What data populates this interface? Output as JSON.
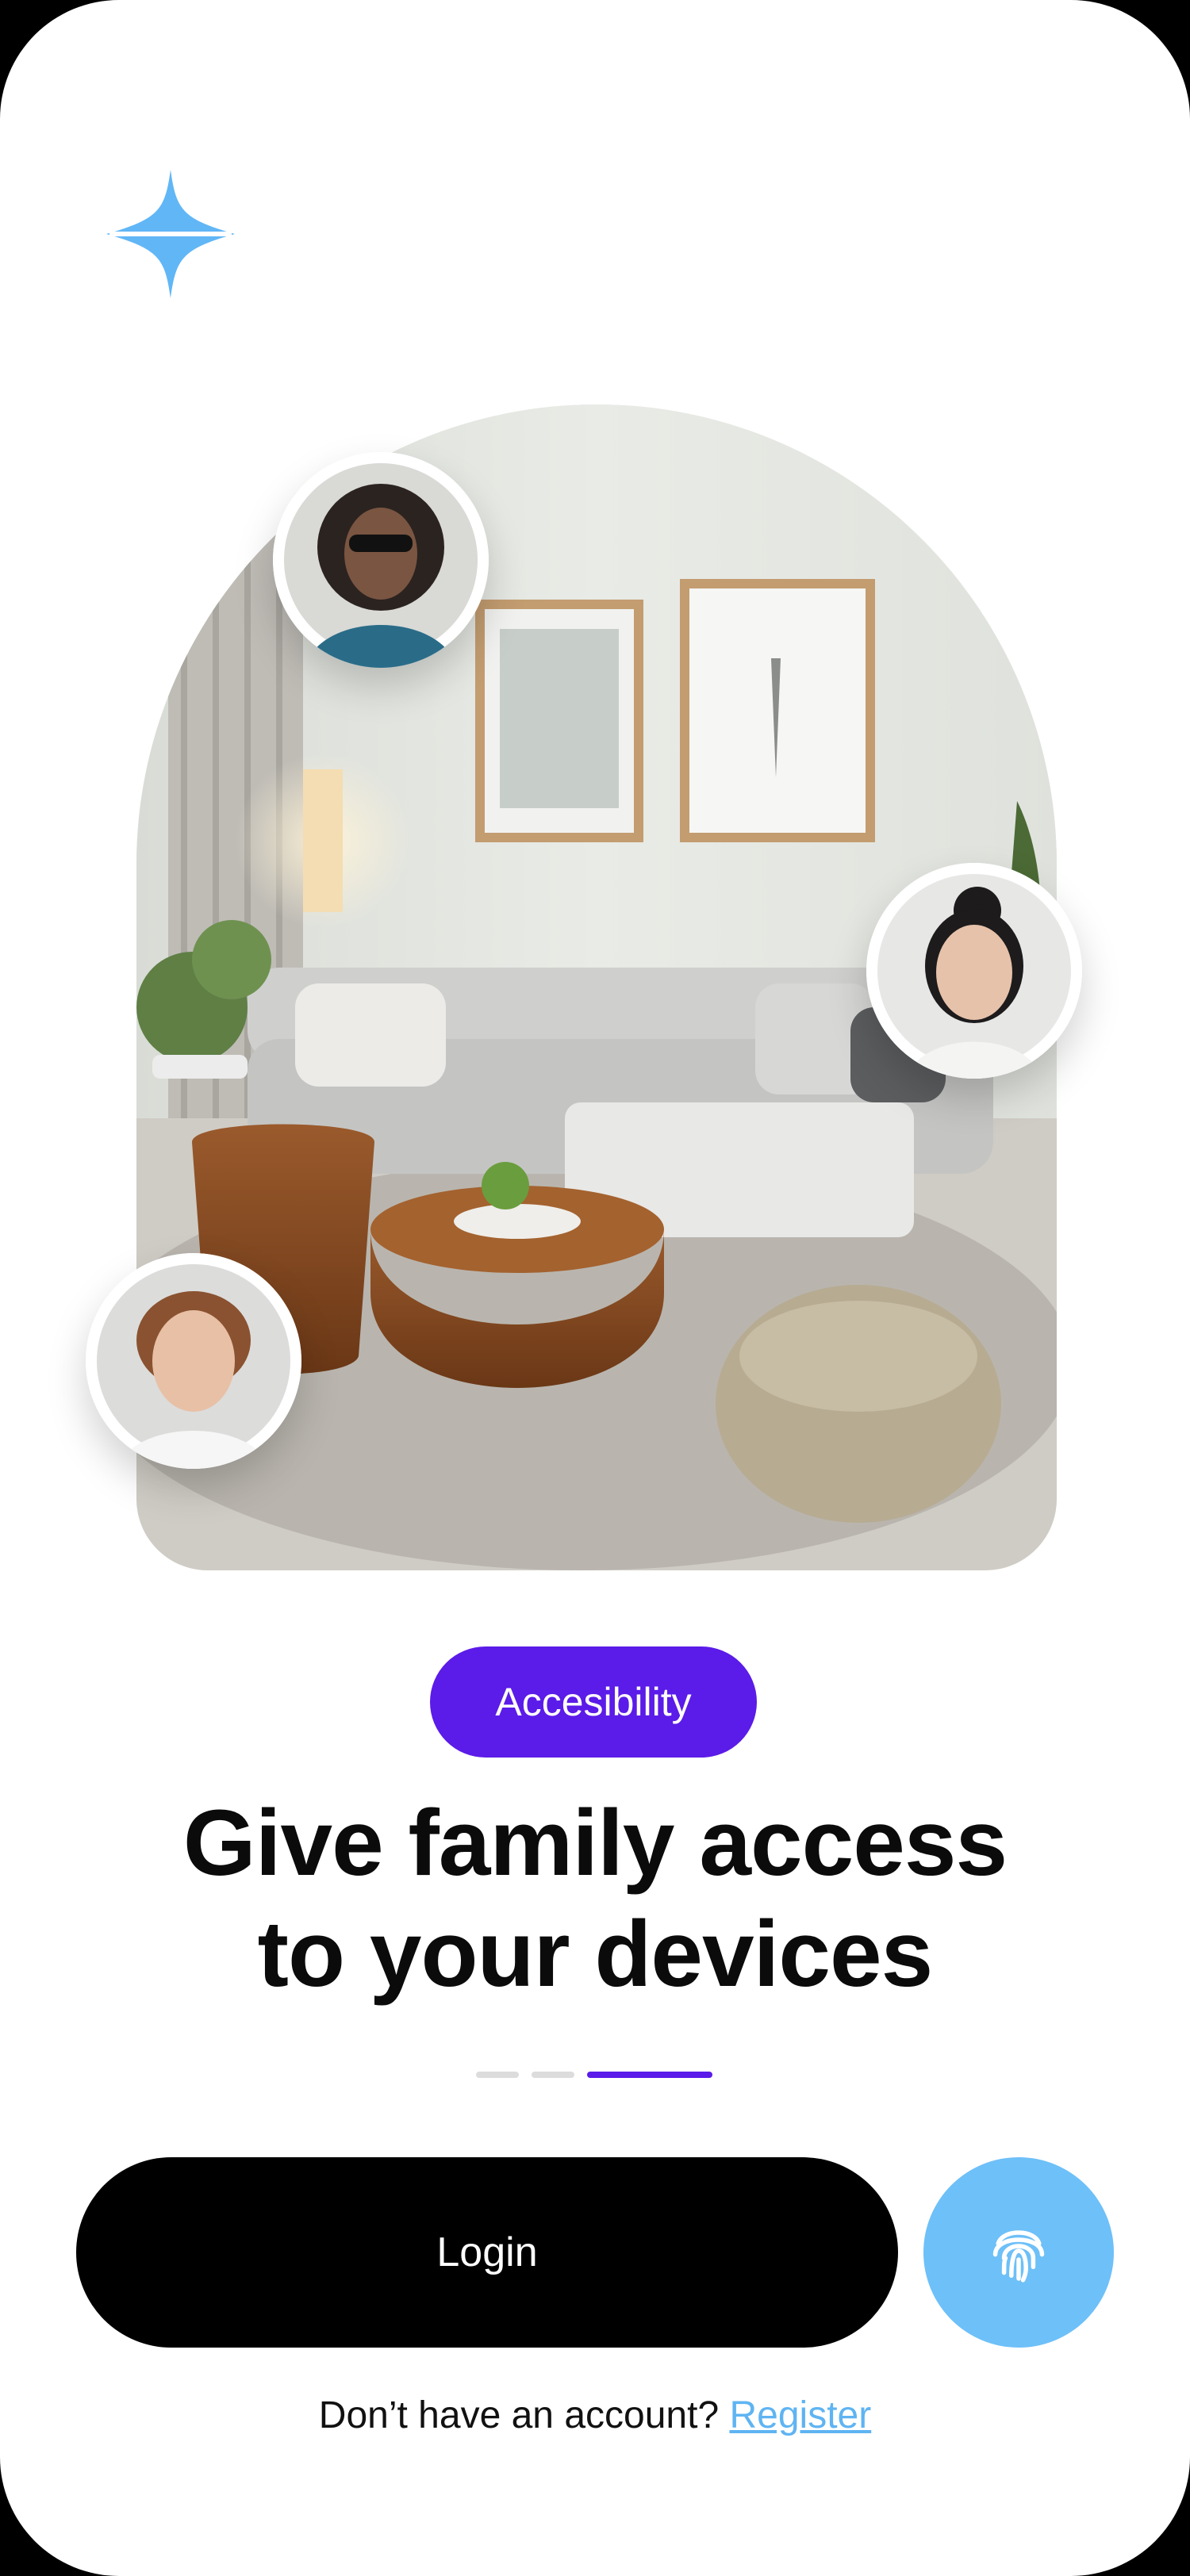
{
  "app": {
    "logo_icon": "four-point-star-icon",
    "accent_color": "#5b1be8",
    "secondary_color": "#6ec0f8"
  },
  "hero": {
    "image": "living-room-photo",
    "avatars": [
      "person-curly-hair-sunglasses",
      "person-woman-dark-hair-bun",
      "person-young-man-wavy-hair"
    ]
  },
  "badge": {
    "label": "Accesibility"
  },
  "headline": {
    "line1": "Give family access",
    "line2": "to your devices"
  },
  "pager": {
    "count": 3,
    "active_index": 2
  },
  "actions": {
    "login_label": "Login",
    "fingerprint_icon": "fingerprint-icon"
  },
  "footer": {
    "prompt": "Don’t have an account?",
    "register_label": "Register"
  }
}
